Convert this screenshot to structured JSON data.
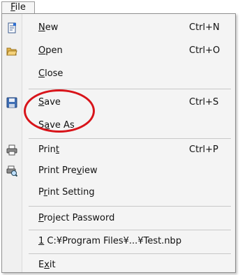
{
  "menu": {
    "title_key": "F",
    "title_rest": "ile",
    "items": [
      {
        "key": "N",
        "rest": "ew",
        "shortcut": "Ctrl+N",
        "icon": "new-file-icon"
      },
      {
        "key": "O",
        "rest": "pen",
        "shortcut": "Ctrl+O",
        "icon": "open-folder-icon"
      },
      {
        "key": "C",
        "rest": "lose",
        "shortcut": "",
        "icon": ""
      },
      {
        "key": "S",
        "rest": "ave",
        "shortcut": "Ctrl+S",
        "icon": "save-icon"
      },
      {
        "pre": "S",
        "key": "a",
        "rest": "ve As",
        "shortcut": "",
        "icon": ""
      },
      {
        "pre": "Prin",
        "key": "t",
        "rest": "",
        "shortcut": "Ctrl+P",
        "icon": "print-icon"
      },
      {
        "pre": "Print Pre",
        "key": "v",
        "rest": "iew",
        "shortcut": "",
        "icon": "print-preview-icon"
      },
      {
        "pre": "P",
        "key": "r",
        "rest": "int Setting",
        "shortcut": "",
        "icon": ""
      },
      {
        "key": "P",
        "rest": "roject Password",
        "shortcut": "",
        "icon": ""
      },
      {
        "key": "1",
        "rest": " C:¥Program Files¥...¥Test.nbp",
        "shortcut": "",
        "icon": ""
      },
      {
        "pre": "E",
        "key": "x",
        "rest": "it",
        "shortcut": "",
        "icon": ""
      }
    ]
  },
  "colors": {
    "annotation": "#d8141a",
    "menu_background": "#f4f4f4"
  }
}
